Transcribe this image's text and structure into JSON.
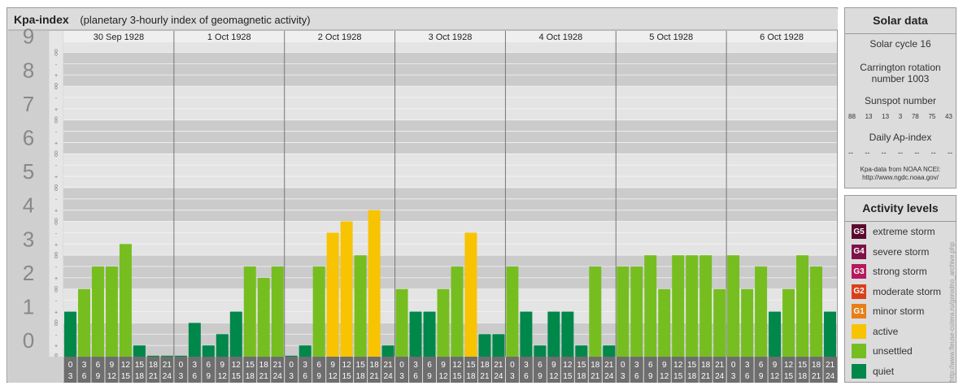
{
  "header": {
    "title": "Kpa-index",
    "subtitle": "(planetary 3-hourly index of geomagnetic activity)"
  },
  "chart_data": {
    "type": "bar",
    "title": "Kpa-index",
    "subtitle": "(planetary 3-hourly index of geomagnetic activity)",
    "ylim": [
      0,
      9.3
    ],
    "y_ticks": [
      "0",
      "1",
      "2",
      "3",
      "4",
      "5",
      "6",
      "7",
      "8",
      "9"
    ],
    "minor_ticks": [
      "o",
      "+",
      "-",
      "o"
    ],
    "days": [
      "30 Sep 1928",
      "1 Oct 1928",
      "2 Oct 1928",
      "3 Oct 1928",
      "4 Oct 1928",
      "5 Oct 1928",
      "6 Oct 1928"
    ],
    "hour_top": [
      "0",
      "3",
      "6",
      "9",
      "12",
      "15",
      "18",
      "21"
    ],
    "hour_bottom": [
      "3",
      "6",
      "9",
      "12",
      "15",
      "18",
      "21",
      "24"
    ],
    "values": [
      1.333,
      2.0,
      2.667,
      2.667,
      3.333,
      0.333,
      0.0,
      0.0,
      0.0,
      1.0,
      0.333,
      0.667,
      1.333,
      2.667,
      2.333,
      2.667,
      0.0,
      0.333,
      2.667,
      3.667,
      4.0,
      3.0,
      4.333,
      0.333,
      2.0,
      1.333,
      1.333,
      2.0,
      2.667,
      3.667,
      0.667,
      0.667,
      2.667,
      1.333,
      0.333,
      1.333,
      1.333,
      0.333,
      2.667,
      0.333,
      2.667,
      2.667,
      3.0,
      2.0,
      3.0,
      3.0,
      3.0,
      2.0,
      3.0,
      2.0,
      2.667,
      1.333,
      2.0,
      3.0,
      2.667,
      1.333
    ],
    "levels": [
      "quiet",
      "unsettled",
      "unsettled",
      "unsettled",
      "unsettled",
      "quiet",
      "quiet",
      "quiet",
      "quiet",
      "quiet",
      "quiet",
      "quiet",
      "quiet",
      "unsettled",
      "unsettled",
      "unsettled",
      "quiet",
      "quiet",
      "unsettled",
      "active",
      "active",
      "unsettled",
      "active",
      "quiet",
      "unsettled",
      "quiet",
      "quiet",
      "unsettled",
      "unsettled",
      "active",
      "quiet",
      "quiet",
      "unsettled",
      "quiet",
      "quiet",
      "quiet",
      "quiet",
      "quiet",
      "unsettled",
      "quiet",
      "unsettled",
      "unsettled",
      "unsettled",
      "unsettled",
      "unsettled",
      "unsettled",
      "unsettled",
      "unsettled",
      "unsettled",
      "unsettled",
      "unsettled",
      "quiet",
      "unsettled",
      "unsettled",
      "unsettled",
      "quiet"
    ],
    "level_colors": {
      "quiet": "#00874a",
      "unsettled": "#76be20",
      "active": "#f8c300"
    }
  },
  "solar": {
    "title": "Solar data",
    "cycle": "Solar cycle 16",
    "carrington_line1": "Carrington rotation",
    "carrington_line2": "number 1003",
    "sunspot_label": "Sunspot number",
    "sunspot_values": [
      "88",
      "13",
      "13",
      "3",
      "78",
      "75",
      "43"
    ],
    "ap_label": "Daily Ap-index",
    "ap_values": [
      "--",
      "--",
      "--",
      "--",
      "--",
      "--",
      "--"
    ],
    "credit_line1": "Kpa-data from NOAA NCEI:",
    "credit_line2": "http://www.ngdc.noaa.gov/"
  },
  "activity": {
    "title": "Activity levels",
    "items": [
      {
        "code": "G5",
        "label": "extreme storm",
        "color": "#5a0a2e"
      },
      {
        "code": "G4",
        "label": "severe storm",
        "color": "#7d1248"
      },
      {
        "code": "G3",
        "label": "strong storm",
        "color": "#b5195e"
      },
      {
        "code": "G2",
        "label": "moderate storm",
        "color": "#d8401c"
      },
      {
        "code": "G1",
        "label": "minor storm",
        "color": "#e87e16"
      },
      {
        "code": "",
        "label": "active",
        "color": "#f8c300"
      },
      {
        "code": "",
        "label": "unsettled",
        "color": "#76be20"
      },
      {
        "code": "",
        "label": "quiet",
        "color": "#00874a"
      }
    ]
  },
  "watermark": "http://www.fleuse-cutera.ru/gorodno_archive.php"
}
